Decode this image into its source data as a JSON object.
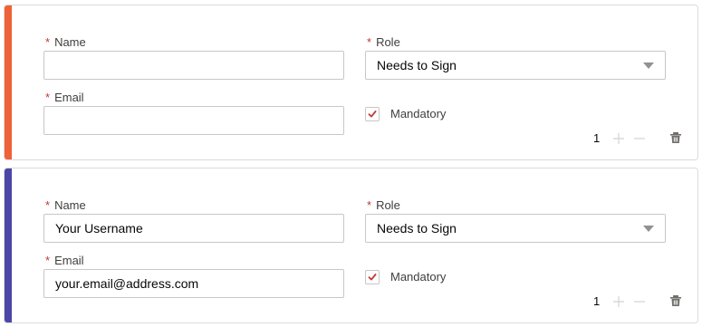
{
  "colors": {
    "card1_accent": "#ef6138",
    "card2_accent": "#4b47a6",
    "required_star": "#c23934",
    "checkmark": "#c23934"
  },
  "labels": {
    "required_mark": "*",
    "name": "Name",
    "email": "Email",
    "role": "Role",
    "mandatory": "Mandatory"
  },
  "recipients": [
    {
      "name_value": "",
      "email_value": "",
      "role_selected": "Needs to Sign",
      "mandatory_checked": true,
      "count": "1",
      "icons": {
        "add": "plus-icon",
        "remove": "minus-icon",
        "delete": "trash-icon",
        "role_dropdown": "chevron-down-icon",
        "check": "checkmark-icon"
      }
    },
    {
      "name_value": "Your Username",
      "email_value": "your.email@address.com",
      "role_selected": "Needs to Sign",
      "mandatory_checked": true,
      "count": "1",
      "icons": {
        "add": "plus-icon",
        "remove": "minus-icon",
        "delete": "trash-icon",
        "role_dropdown": "chevron-down-icon",
        "check": "checkmark-icon"
      }
    }
  ]
}
